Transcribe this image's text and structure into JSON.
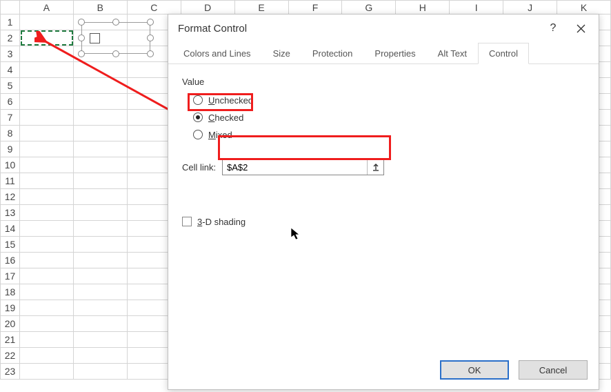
{
  "sheet": {
    "columns": [
      "A",
      "B",
      "C",
      "D",
      "E",
      "F",
      "G",
      "H",
      "I",
      "J",
      "K"
    ],
    "rows": [
      "1",
      "2",
      "3",
      "4",
      "5",
      "6",
      "7",
      "8",
      "9",
      "10",
      "11",
      "12",
      "13",
      "14",
      "15",
      "16",
      "17",
      "18",
      "19",
      "20",
      "21",
      "22",
      "23"
    ]
  },
  "dialog": {
    "title": "Format Control",
    "help_label": "?",
    "tabs": {
      "colors": "Colors and Lines",
      "size": "Size",
      "protection": "Protection",
      "properties": "Properties",
      "alttext": "Alt Text",
      "control": "Control"
    },
    "value_label": "Value",
    "radio": {
      "unchecked": "nchecked",
      "unchecked_u": "U",
      "checked": "hecked",
      "checked_u": "C",
      "mixed": "ixed",
      "mixed_u": "M"
    },
    "cell_link_label": "Cell link:",
    "cell_link_value": "$A$2",
    "shading_label": "-D shading",
    "shading_u": "3",
    "ok": "OK",
    "cancel": "Cancel"
  }
}
